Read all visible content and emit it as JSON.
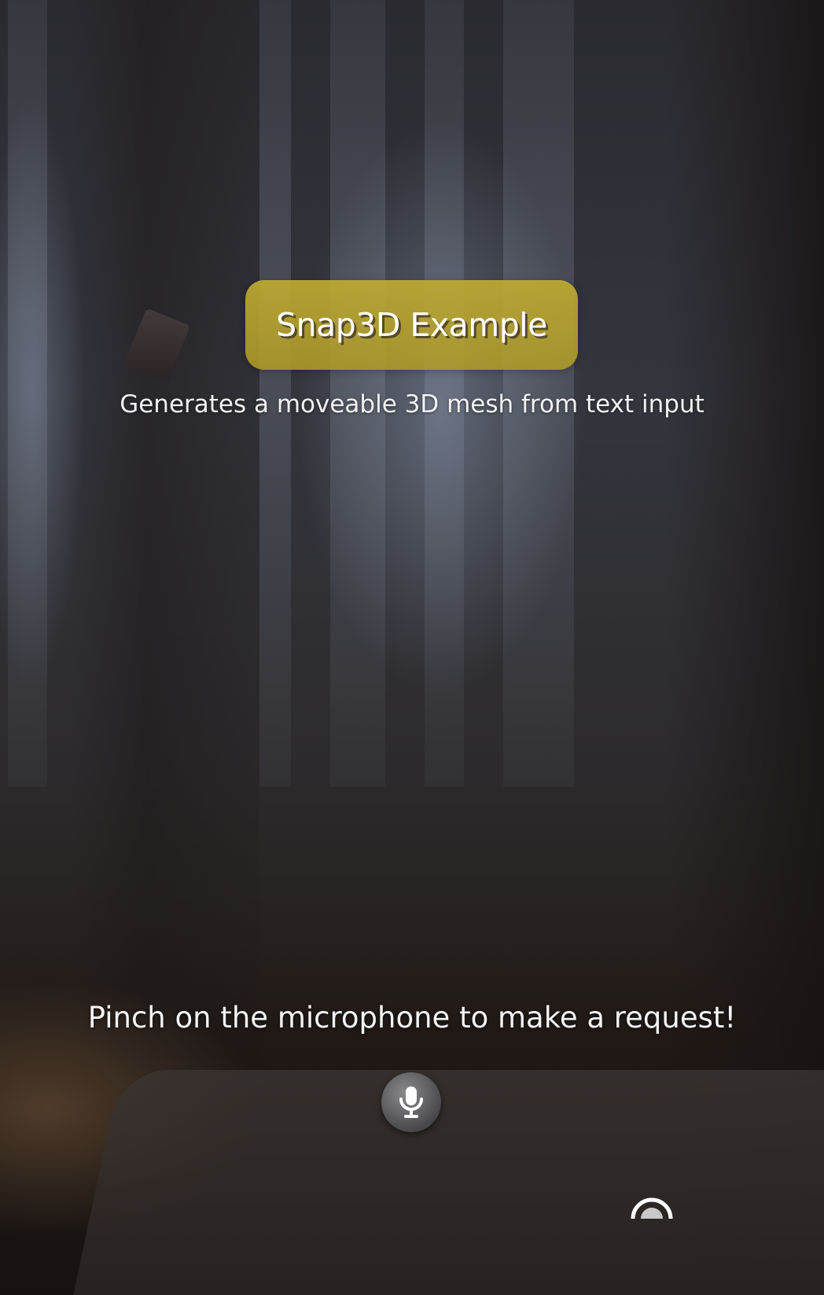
{
  "header": {
    "title": "Snap3D Example",
    "subtitle": "Generates a moveable 3D mesh from text input"
  },
  "prompt": {
    "instruction": "Pinch on the microphone to make a request!"
  },
  "controls": {
    "mic_icon": "microphone-icon",
    "anchor_icon": "hand-anchor-icon"
  },
  "colors": {
    "title_pill": "#bca832",
    "text": "#ffffff"
  }
}
